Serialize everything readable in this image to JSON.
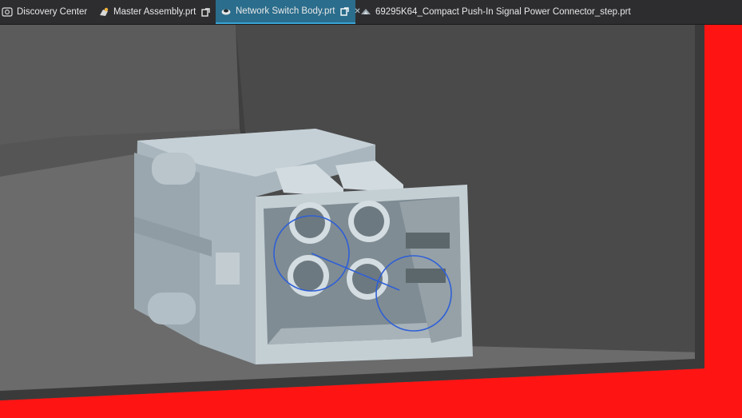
{
  "tabs": [
    {
      "label": "Discovery Center",
      "icon": "discovery-icon",
      "active": false
    },
    {
      "label": "Master Assembly.prt",
      "icon": "assembly-part-icon",
      "active": false
    },
    {
      "label": "Network Switch Body.prt",
      "icon": "part-icon",
      "active": true
    },
    {
      "label": "69295K64_Compact Push-In Signal Power Connector_step.prt",
      "icon": "step-part-icon",
      "active": false
    }
  ],
  "colors": {
    "tabbar_bg": "#2d2d30",
    "active_tab": "#2a6d8c",
    "viewport_bg": "#4a4a4a",
    "highlight_border": "#ff1414",
    "model_face": "#b9c6cd",
    "model_dark": "#8a979e",
    "selection_circle": "#2f5fd6"
  }
}
